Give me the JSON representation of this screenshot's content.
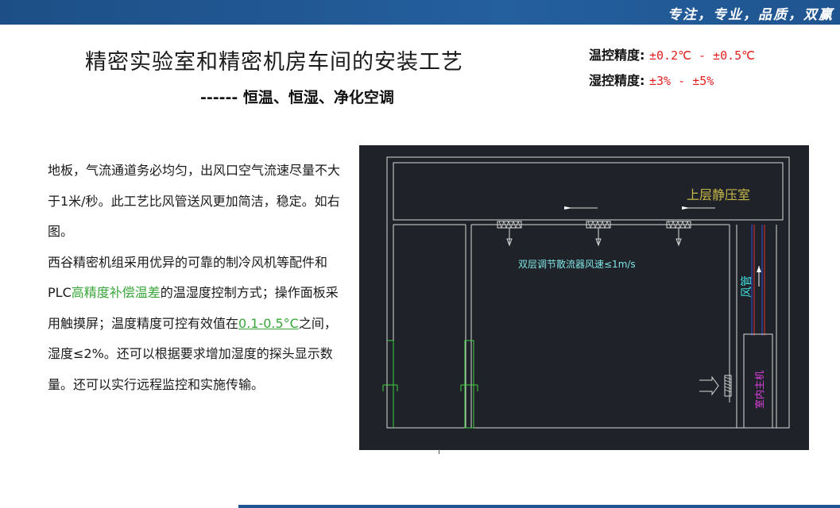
{
  "header": {
    "slogan": "专注，专业，品质，双赢"
  },
  "title": "精密实验室和精密机房车间的安装工艺",
  "subtitle": "------ 恒温、恒湿、净化空调",
  "specs": [
    {
      "label": "温控精度:",
      "value": "±0.2℃ - ±0.5℃"
    },
    {
      "label": "湿控精度:",
      "value": "±3% - ±5%"
    }
  ],
  "body": {
    "p1": "地板，气流通道务必均匀，出风口空气流速尽量不大于1米/秒。此工艺比风管送风更加简洁，稳定。如右图。",
    "p2a": "西谷精密机组采用优异的可靠的制冷风机等配件和PLC",
    "p2hl": "高精度补偿温差",
    "p2b": "的温湿度控制方式；操作面板采用触摸屏；温度精度可控有效值在",
    "p2range": "0.1-0.5°C",
    "p2c": "之间，湿度≤2%。还可以根据要求增加湿度的探头显示数量。还可以实行远程监控和实施传输。"
  },
  "diagram": {
    "upper_plenum_label": "上层静压室",
    "diffuser_label": "双层调节散流器风速≤1m/s",
    "duct_label": "风管",
    "unit_label": "室内主机",
    "colors": {
      "background": "#1f2329",
      "line": "#d8d8d8",
      "plenum_label": "#c8b84a",
      "diffuser_label": "#7fe3e3",
      "green": "#3ecf3e",
      "red": "#e03030",
      "blue": "#3050e0",
      "magenta": "#e040e0",
      "cyan": "#40e0e0"
    }
  }
}
